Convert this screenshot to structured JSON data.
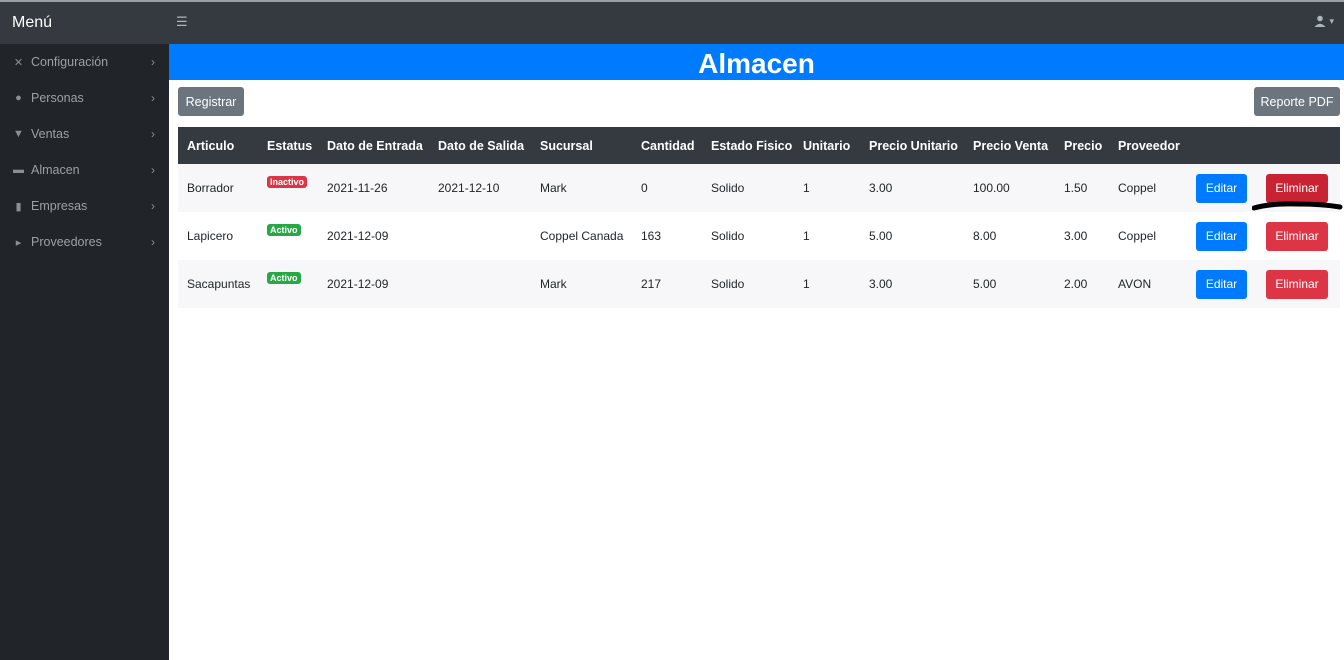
{
  "topbar": {
    "brand": "Menú",
    "hamburger_icon": "☰",
    "user_icon": "user-icon"
  },
  "sidebar": {
    "items": [
      {
        "label": "Configuración",
        "icon": "tools-icon"
      },
      {
        "label": "Personas",
        "icon": "users-icon"
      },
      {
        "label": "Ventas",
        "icon": "cart-icon"
      },
      {
        "label": "Almacen",
        "icon": "warehouse-icon"
      },
      {
        "label": "Empresas",
        "icon": "building-icon"
      },
      {
        "label": "Proveedores",
        "icon": "truck-icon"
      }
    ]
  },
  "page": {
    "title": "Almacen",
    "register_label": "Registrar",
    "pdf_label": "Reporte PDF"
  },
  "table": {
    "headers": [
      "Articulo",
      "Estatus",
      "Dato de Entrada",
      "Dato de Salida",
      "Sucursal",
      "Cantidad",
      "Estado Fisico",
      "Unitario",
      "Precio Unitario",
      "Precio Venta",
      "Precio",
      "Proveedor",
      "",
      ""
    ],
    "rows": [
      {
        "articulo": "Borrador",
        "estatus": "Inactivo",
        "entrada": "2021-11-26",
        "salida": "2021-12-10",
        "sucursal": "Mark",
        "cantidad": "0",
        "estado": "Solido",
        "unitario": "1",
        "precio_unitario": "3.00",
        "precio_venta": "100.00",
        "precio": "1.50",
        "proveedor": "Coppel",
        "edit": "Editar",
        "delete": "Eliminar"
      },
      {
        "articulo": "Lapicero",
        "estatus": "Activo",
        "entrada": "2021-12-09",
        "salida": "",
        "sucursal": "Coppel Canada",
        "cantidad": "163",
        "estado": "Solido",
        "unitario": "1",
        "precio_unitario": "5.00",
        "precio_venta": "8.00",
        "precio": "3.00",
        "proveedor": "Coppel",
        "edit": "Editar",
        "delete": "Eliminar"
      },
      {
        "articulo": "Sacapuntas",
        "estatus": "Activo",
        "entrada": "2021-12-09",
        "salida": "",
        "sucursal": "Mark",
        "cantidad": "217",
        "estado": "Solido",
        "unitario": "1",
        "precio_unitario": "3.00",
        "precio_venta": "5.00",
        "precio": "2.00",
        "proveedor": "AVON",
        "edit": "Editar",
        "delete": "Eliminar"
      }
    ]
  },
  "colors": {
    "topbar": "#343a40",
    "sidebar": "#212529",
    "primary": "#007bff",
    "danger": "#dc3545",
    "success": "#28a745",
    "secondary": "#6c757d"
  }
}
